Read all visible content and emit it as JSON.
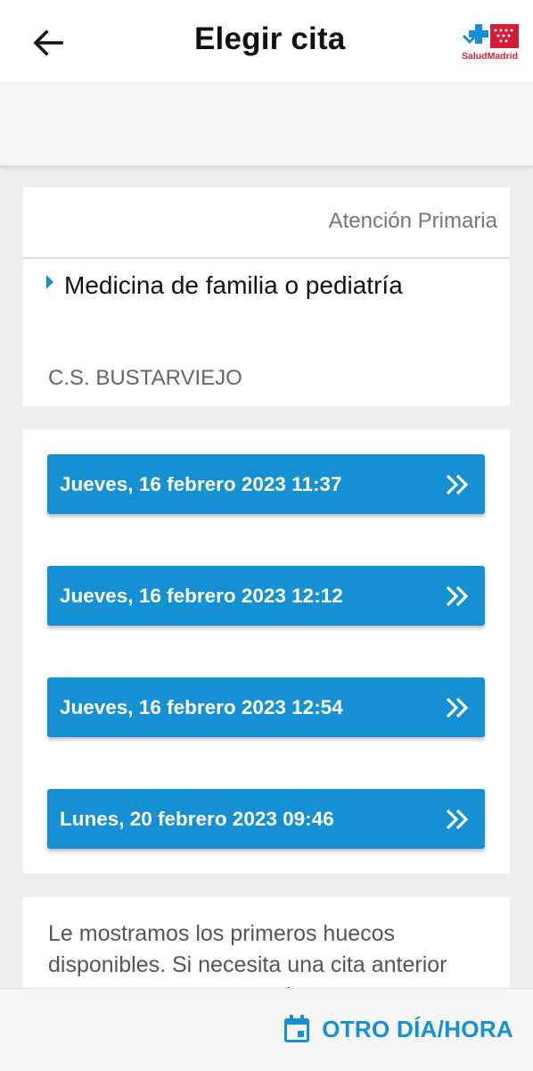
{
  "header": {
    "title": "Elegir cita",
    "logo_text": "SaludMadrid",
    "back_icon": "arrow-left-icon"
  },
  "info": {
    "category": "Atención Primaria",
    "service": "Medicina de familia o pediatría",
    "center": "C.S. BUSTARVIEJO"
  },
  "slots": [
    {
      "label": "Jueves, 16 febrero 2023 11:37"
    },
    {
      "label": "Jueves, 16 febrero 2023 12:12"
    },
    {
      "label": "Jueves, 16 febrero 2023 12:54"
    },
    {
      "label": "Lunes, 20 febrero 2023 09:46"
    }
  ],
  "note": "Le mostramos los primeros huecos disponibles. Si necesita una cita anterior contacte con su centro de",
  "bottom": {
    "other_label": "OTRO DÍA/HORA",
    "icon": "calendar-icon"
  },
  "colors": {
    "accent": "#1591d3",
    "brand_red": "#d41d36"
  }
}
